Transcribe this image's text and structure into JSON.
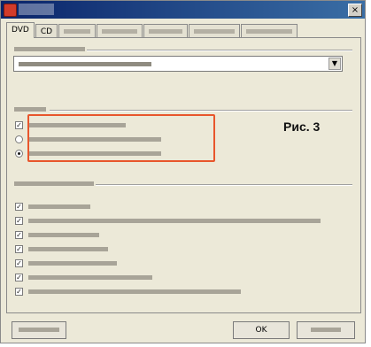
{
  "window": {
    "title": ""
  },
  "tabs": [
    {
      "label": "DVD"
    },
    {
      "label": "CD"
    },
    {
      "label": ""
    },
    {
      "label": ""
    },
    {
      "label": ""
    },
    {
      "label": ""
    },
    {
      "label": ""
    }
  ],
  "region_group": {
    "label": "",
    "selected_value": ""
  },
  "navigation_group": {
    "label": "",
    "options": [
      {
        "kind": "checkbox",
        "checked": true,
        "label": ""
      },
      {
        "kind": "radio",
        "checked": false,
        "label": ""
      },
      {
        "kind": "radio",
        "checked": true,
        "label": ""
      }
    ]
  },
  "features_group": {
    "label": "",
    "options": [
      {
        "checked": true,
        "label": ""
      },
      {
        "checked": true,
        "label": ""
      },
      {
        "checked": true,
        "label": ""
      },
      {
        "checked": true,
        "label": ""
      },
      {
        "checked": true,
        "label": ""
      },
      {
        "checked": true,
        "label": ""
      },
      {
        "checked": true,
        "label": ""
      }
    ]
  },
  "figure_caption": "Рис. 3",
  "buttons": {
    "defaults": "",
    "ok": "OK",
    "cancel": ""
  },
  "colors": {
    "highlight": "#e8562c",
    "titlebar": "#0a246a"
  },
  "icons": {
    "app": "app-icon",
    "combo_arrow": "chevron-down-icon",
    "close": "close-icon"
  }
}
